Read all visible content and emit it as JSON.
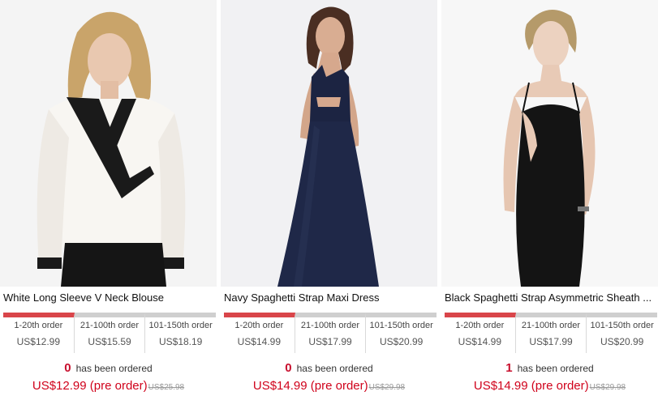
{
  "products": [
    {
      "name": "White Long Sleeve V Neck Blouse",
      "image_icon": "product-photo-white-blouse",
      "tiers": [
        {
          "range": "1-20th order",
          "price": "US$12.99"
        },
        {
          "range": "21-100th order",
          "price": "US$15.59"
        },
        {
          "range": "101-150th order",
          "price": "US$18.19"
        }
      ],
      "order_count": "0",
      "order_text": "has been ordered",
      "price_label": "US$12.99 (pre order)",
      "old_price": "US$25.98"
    },
    {
      "name": "Navy Spaghetti Strap Maxi Dress",
      "image_icon": "product-photo-navy-maxi-dress",
      "tiers": [
        {
          "range": "1-20th order",
          "price": "US$14.99"
        },
        {
          "range": "21-100th order",
          "price": "US$17.99"
        },
        {
          "range": "101-150th order",
          "price": "US$20.99"
        }
      ],
      "order_count": "0",
      "order_text": "has been ordered",
      "price_label": "US$14.99 (pre order)",
      "old_price": "US$29.98"
    },
    {
      "name": "Black Spaghetti Strap Asymmetric Sheath ...",
      "image_icon": "product-photo-black-sheath-dress",
      "tiers": [
        {
          "range": "1-20th order",
          "price": "US$14.99"
        },
        {
          "range": "21-100th order",
          "price": "US$17.99"
        },
        {
          "range": "101-150th order",
          "price": "US$20.99"
        }
      ],
      "order_count": "1",
      "order_text": "has been ordered",
      "price_label": "US$14.99 (pre order)",
      "old_price": "US$29.98"
    }
  ],
  "colors": {
    "active_tier": "#d9454a",
    "inactive_tier": "#cfcfcf",
    "sale_price": "#d0021b",
    "order_count": "#c8102e"
  }
}
